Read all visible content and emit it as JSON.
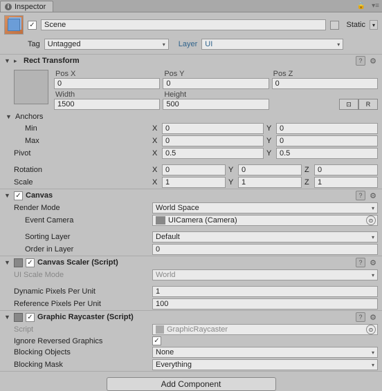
{
  "tab_title": "Inspector",
  "header": {
    "name": "Scene",
    "static_label": "Static",
    "tag_label": "Tag",
    "tag_value": "Untagged",
    "layer_label": "Layer",
    "layer_value": "UI"
  },
  "rect_transform": {
    "title": "Rect Transform",
    "pos_x_label": "Pos X",
    "pos_x": "0",
    "pos_y_label": "Pos Y",
    "pos_y": "0",
    "pos_z_label": "Pos Z",
    "pos_z": "0",
    "width_label": "Width",
    "width": "1500",
    "height_label": "Height",
    "height": "500",
    "r_button": "R",
    "anchors_label": "Anchors",
    "min_label": "Min",
    "min_x": "0",
    "min_y": "0",
    "max_label": "Max",
    "max_x": "0",
    "max_y": "0",
    "pivot_label": "Pivot",
    "pivot_x": "0.5",
    "pivot_y": "0.5",
    "rotation_label": "Rotation",
    "rot_x": "0",
    "rot_y": "0",
    "rot_z": "0",
    "scale_label": "Scale",
    "scale_x": "1",
    "scale_y": "1",
    "scale_z": "1",
    "x": "X",
    "y": "Y",
    "z": "Z"
  },
  "canvas": {
    "title": "Canvas",
    "render_mode_label": "Render Mode",
    "render_mode_value": "World Space",
    "event_camera_label": "Event Camera",
    "event_camera_value": "UICamera (Camera)",
    "sorting_layer_label": "Sorting Layer",
    "sorting_layer_value": "Default",
    "order_label": "Order in Layer",
    "order_value": "0"
  },
  "canvas_scaler": {
    "title": "Canvas Scaler (Script)",
    "ui_scale_mode_label": "UI Scale Mode",
    "ui_scale_mode_value": "World",
    "dynamic_ppu_label": "Dynamic Pixels Per Unit",
    "dynamic_ppu_value": "1",
    "reference_ppu_label": "Reference Pixels Per Unit",
    "reference_ppu_value": "100"
  },
  "graphic_raycaster": {
    "title": "Graphic Raycaster (Script)",
    "script_label": "Script",
    "script_value": "GraphicRaycaster",
    "ignore_reversed_label": "Ignore Reversed Graphics",
    "blocking_objects_label": "Blocking Objects",
    "blocking_objects_value": "None",
    "blocking_mask_label": "Blocking Mask",
    "blocking_mask_value": "Everything"
  },
  "add_component_label": "Add Component"
}
